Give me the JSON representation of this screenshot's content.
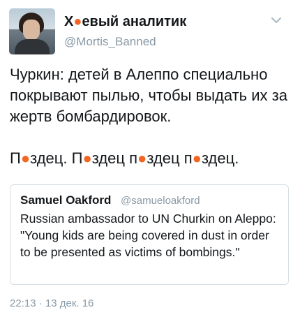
{
  "author": {
    "display_name": "Х●евый аналитик",
    "handle": "@Mortis_Banned"
  },
  "tweet": {
    "text": "Чуркин: детей в Алеппо специально покрывают пылью, чтобы выдать их за жертв бомбардировок.\n\nП●здец. П●здец п●здец п●здец."
  },
  "quoted_tweet": {
    "author_name": "Samuel Oakford",
    "author_handle": "@samueloakford",
    "text": "Russian ambassador to UN Churkin on Aleppo: \"Young kids are being covered in dust in order to be presented as victims of bombings.\""
  },
  "meta": {
    "timestamp": "22:13 · 13 дек. 16"
  },
  "icons": {
    "menu": "chevron-down-icon"
  },
  "colors": {
    "text": "#14171a",
    "secondary": "#8899a6",
    "border": "#d5dde2",
    "censor_dot": "#f26522"
  }
}
